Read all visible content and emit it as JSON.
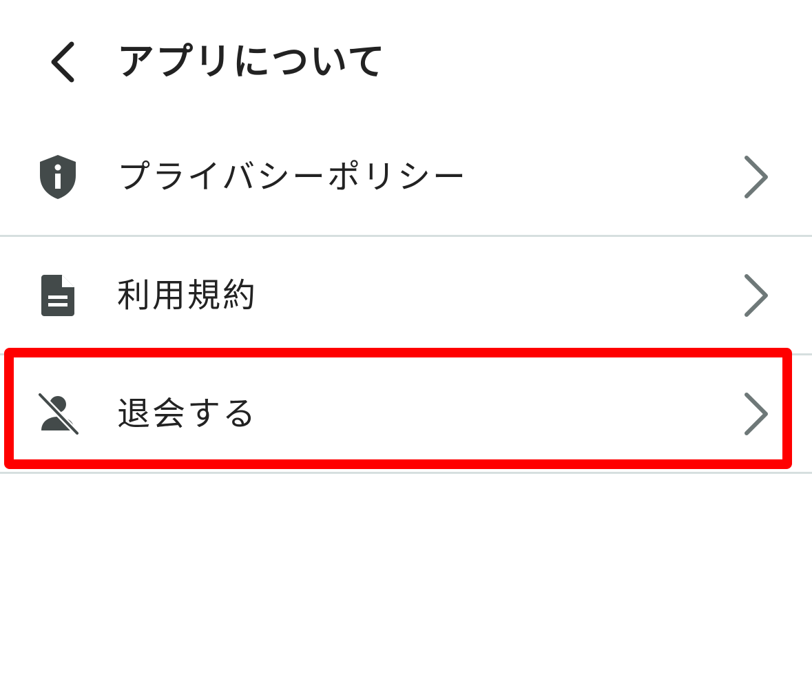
{
  "header": {
    "title": "アプリについて",
    "back_icon": "chevron-left-icon"
  },
  "menu": {
    "items": [
      {
        "id": "privacy-policy",
        "label": "プライバシーポリシー",
        "icon": "shield-info-icon"
      },
      {
        "id": "terms",
        "label": "利用規約",
        "icon": "document-icon"
      },
      {
        "id": "withdraw",
        "label": "退会する",
        "icon": "person-off-icon",
        "highlighted": true
      }
    ],
    "trailing_icon": "chevron-right-icon"
  },
  "colors": {
    "icon": "#434a4a",
    "chevron": "#6e7878",
    "divider": "#d6dfdf",
    "highlight": "#ff0000",
    "text": "#222222"
  }
}
